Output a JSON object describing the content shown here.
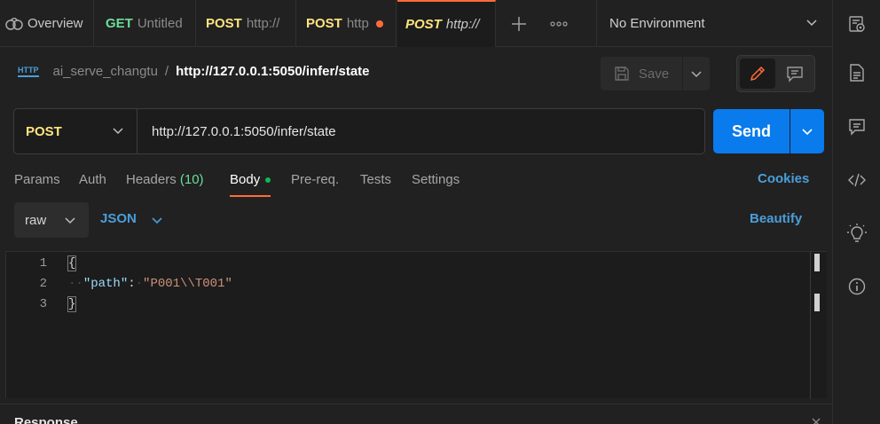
{
  "tabs": [
    {
      "method": "",
      "name": "Overview",
      "icon": "overview-icon"
    },
    {
      "method": "GET",
      "name": "Untitled"
    },
    {
      "method": "POST",
      "name": "http://"
    },
    {
      "method": "POST",
      "name": "http",
      "unsaved": true
    },
    {
      "method": "POST",
      "name": "http://",
      "active": true
    }
  ],
  "environment": {
    "label": "No Environment"
  },
  "breadcrumb": {
    "icon_text": "HTTP",
    "collection": "ai_serve_changtu",
    "separator": "/",
    "request": "http://127.0.0.1:5050/infer/state"
  },
  "toolbar": {
    "save_label": "Save"
  },
  "request": {
    "method": "POST",
    "url": "http://127.0.0.1:5050/infer/state",
    "send_label": "Send"
  },
  "request_tabs": {
    "params": "Params",
    "auth": "Auth",
    "headers": "Headers",
    "headers_count": "(10)",
    "body": "Body",
    "prereq": "Pre-req.",
    "tests": "Tests",
    "settings": "Settings",
    "cookies": "Cookies"
  },
  "body_toolbar": {
    "mode": "raw",
    "language": "JSON",
    "beautify": "Beautify"
  },
  "editor": {
    "line_numbers": [
      "1",
      "2",
      "3"
    ],
    "open_brace": "{",
    "key": "\"path\"",
    "colon": ":",
    "value": "\"P001\\\\T001\"",
    "close_brace": "}"
  },
  "response": {
    "label": "Response"
  },
  "colors": {
    "accent": "#ff6c37",
    "send": "#097bed",
    "link": "#4a9eda",
    "get": "#6bdd9a",
    "post": "#ffe47e"
  }
}
